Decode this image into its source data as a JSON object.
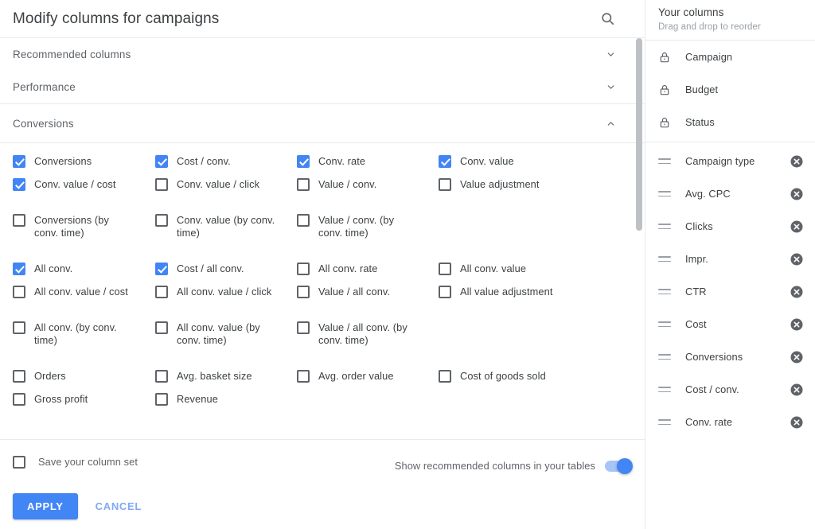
{
  "dialog": {
    "title": "Modify columns for campaigns",
    "search_icon": "search-icon"
  },
  "sections": [
    {
      "label": "Recommended columns",
      "expanded": false,
      "chevron": "chevron-down-icon"
    },
    {
      "label": "Performance",
      "expanded": false,
      "chevron": "chevron-down-icon"
    },
    {
      "label": "Conversions",
      "expanded": true,
      "chevron": "chevron-up-icon"
    }
  ],
  "conversions_groups": [
    {
      "rows": [
        [
          {
            "label": "Conversions",
            "checked": true
          },
          {
            "label": "Cost / conv.",
            "checked": true
          },
          {
            "label": "Conv. rate",
            "checked": true
          },
          {
            "label": "Conv. value",
            "checked": true
          }
        ],
        [
          {
            "label": "Conv. value / cost",
            "checked": true
          },
          {
            "label": "Conv. value / click",
            "checked": false
          },
          {
            "label": "Value / conv.",
            "checked": false
          },
          {
            "label": "Value adjustment",
            "checked": false
          }
        ]
      ]
    },
    {
      "rows": [
        [
          {
            "label": "Conversions (by conv. time)",
            "checked": false
          },
          {
            "label": "Conv. value (by conv. time)",
            "checked": false
          },
          {
            "label": "Value / conv. (by conv. time)",
            "checked": false
          },
          {
            "label": "",
            "checked": false,
            "empty": true
          }
        ]
      ]
    },
    {
      "rows": [
        [
          {
            "label": "All conv.",
            "checked": true
          },
          {
            "label": "Cost / all conv.",
            "checked": true
          },
          {
            "label": "All conv. rate",
            "checked": false
          },
          {
            "label": "All conv. value",
            "checked": false
          }
        ],
        [
          {
            "label": "All conv. value / cost",
            "checked": false
          },
          {
            "label": "All conv. value / click",
            "checked": false
          },
          {
            "label": "Value / all conv.",
            "checked": false
          },
          {
            "label": "All value adjustment",
            "checked": false
          }
        ]
      ]
    },
    {
      "rows": [
        [
          {
            "label": "All conv. (by conv. time)",
            "checked": false
          },
          {
            "label": "All conv. value (by conv. time)",
            "checked": false
          },
          {
            "label": "Value / all conv. (by conv. time)",
            "checked": false
          },
          {
            "label": "",
            "checked": false,
            "empty": true
          }
        ]
      ]
    },
    {
      "rows": [
        [
          {
            "label": "Orders",
            "checked": false
          },
          {
            "label": "Avg. basket size",
            "checked": false
          },
          {
            "label": "Avg. order value",
            "checked": false
          },
          {
            "label": "Cost of goods sold",
            "checked": false
          }
        ],
        [
          {
            "label": "Gross profit",
            "checked": false
          },
          {
            "label": "Revenue",
            "checked": false
          },
          {
            "label": "",
            "checked": false,
            "empty": true
          },
          {
            "label": "",
            "checked": false,
            "empty": true
          }
        ]
      ]
    }
  ],
  "footer": {
    "save_set_label": "Save your column set",
    "save_set_checked": false,
    "apply_label": "APPLY",
    "cancel_label": "CANCEL",
    "toggle_label": "Show recommended columns in your tables",
    "toggle_on": true
  },
  "your_columns": {
    "title": "Your columns",
    "subtitle": "Drag and drop to reorder",
    "locked_items": [
      {
        "label": "Campaign",
        "icon": "lock-icon"
      },
      {
        "label": "Budget",
        "icon": "lock-icon"
      },
      {
        "label": "Status",
        "icon": "lock-icon"
      }
    ],
    "draggable_items": [
      {
        "label": "Campaign type"
      },
      {
        "label": "Avg. CPC"
      },
      {
        "label": "Clicks"
      },
      {
        "label": "Impr."
      },
      {
        "label": "CTR"
      },
      {
        "label": "Cost"
      },
      {
        "label": "Conversions"
      },
      {
        "label": "Cost / conv."
      },
      {
        "label": "Conv. rate"
      }
    ]
  },
  "colors": {
    "accent_blue": "#4285f4",
    "cancel_blue": "#80a9f4",
    "text_primary": "#3c4043",
    "text_secondary": "#5f6368",
    "divider": "#e8eaed",
    "remove_gray": "#5f6368",
    "scrollbar": "#bdc1c6"
  }
}
